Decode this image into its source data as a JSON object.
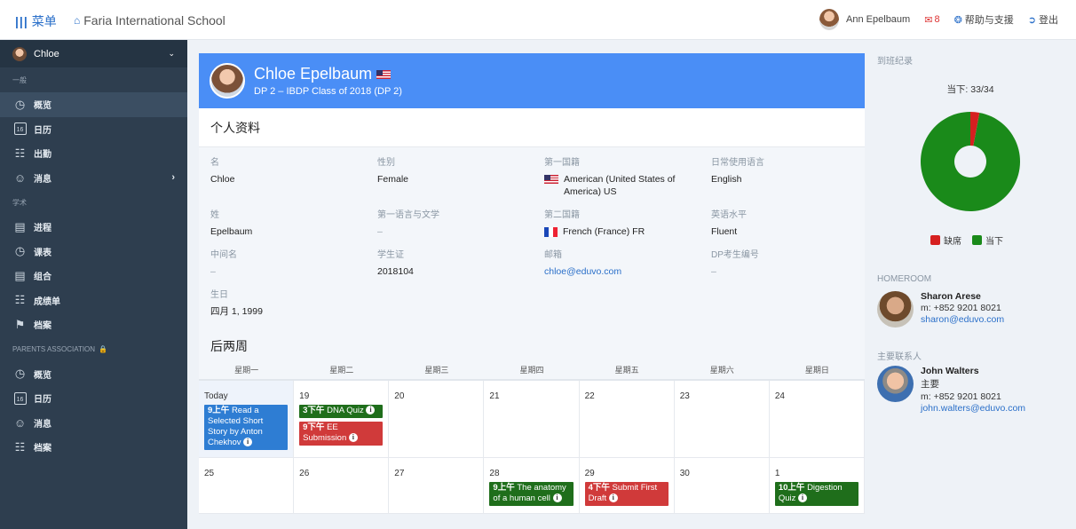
{
  "topbar": {
    "menu_label": "菜单",
    "school_name": "Faria International School",
    "user_name": "Ann Epelbaum",
    "mail_count": "8",
    "help_label": "帮助与支援",
    "logout_label": "登出"
  },
  "sidebar": {
    "current_user": "Chloe",
    "section_general": "一般",
    "general_items": [
      {
        "label": "概览",
        "icon": "dashboard-icon"
      },
      {
        "label": "日历",
        "icon": "calendar-icon",
        "icon_text": "16"
      },
      {
        "label": "出勤",
        "icon": "attendance-icon"
      },
      {
        "label": "消息",
        "icon": "chat-icon"
      }
    ],
    "section_academic": "学术",
    "academic_items": [
      {
        "label": "进程",
        "icon": "progress-icon"
      },
      {
        "label": "课表",
        "icon": "clock-icon"
      },
      {
        "label": "组合",
        "icon": "portfolio-icon"
      },
      {
        "label": "成绩单",
        "icon": "report-icon"
      },
      {
        "label": "档案",
        "icon": "flag-icon"
      }
    ],
    "section_parents": "PARENTS ASSOCIATION",
    "parents_items": [
      {
        "label": "概览",
        "icon": "dashboard-icon"
      },
      {
        "label": "日历",
        "icon": "calendar-icon",
        "icon_text": "16"
      },
      {
        "label": "消息",
        "icon": "chat-icon"
      },
      {
        "label": "档案",
        "icon": "report-icon"
      }
    ]
  },
  "profile": {
    "name": "Chloe Epelbaum",
    "class": "DP 2 – IBDP Class of 2018 (DP 2)"
  },
  "personal": {
    "title": "个人资料",
    "first_name_label": "名",
    "first_name": "Chloe",
    "gender_label": "性别",
    "gender": "Female",
    "nationality1_label": "第一国籍",
    "nationality1": "American (United States of America) US",
    "language_label": "日常使用语言",
    "language": "English",
    "last_name_label": "姓",
    "last_name": "Epelbaum",
    "first_lang_lit_label": "第一语言与文学",
    "first_lang_lit": "–",
    "nationality2_label": "第二国籍",
    "nationality2": "French (France) FR",
    "english_level_label": "英语水平",
    "english_level": "Fluent",
    "middle_name_label": "中间名",
    "middle_name": "–",
    "student_id_label": "学生证",
    "student_id": "2018104",
    "email_label": "邮箱",
    "email": "chloe@eduvo.com",
    "dp_number_label": "DP考生编号",
    "dp_number": "–",
    "birthday_label": "生日",
    "birthday": "四月 1, 1999"
  },
  "calendar": {
    "title": "后两周",
    "weekdays": [
      "星期一",
      "星期二",
      "星期三",
      "星期四",
      "星期五",
      "星期六",
      "星期日"
    ],
    "week1": [
      "Today",
      "19",
      "20",
      "21",
      "22",
      "23",
      "24"
    ],
    "week2": [
      "25",
      "26",
      "27",
      "28",
      "29",
      "30",
      "1"
    ],
    "events": {
      "mon1": {
        "time": "9上午",
        "text": "Read a Selected Short Story by Anton Chekhov"
      },
      "tue1a": {
        "time": "3下午",
        "text": "DNA Quiz"
      },
      "tue1b": {
        "time": "9下午",
        "text": "EE Submission"
      },
      "thu2": {
        "time": "9上午",
        "text": "The anatomy of a human cell"
      },
      "fri2": {
        "time": "4下午",
        "text": "Submit First Draft"
      },
      "sun2": {
        "time": "10上午",
        "text": "Digestion Quiz"
      }
    }
  },
  "attendance": {
    "label": "到班纪录",
    "current": "当下: 33/34",
    "present": 33,
    "total": 34,
    "absent_label": "缺席",
    "present_label": "当下",
    "absent_color": "#d62020",
    "present_color": "#1a8a1a"
  },
  "homeroom": {
    "label": "HOMEROOM",
    "name": "Sharon Arese",
    "phone": "m: +852 9201 8021",
    "email": "sharon@eduvo.com"
  },
  "primary_contact": {
    "label": "主要联系人",
    "name": "John Walters",
    "role": "主要",
    "phone": "m: +852 9201 8021",
    "email": "john.walters@eduvo.com"
  }
}
